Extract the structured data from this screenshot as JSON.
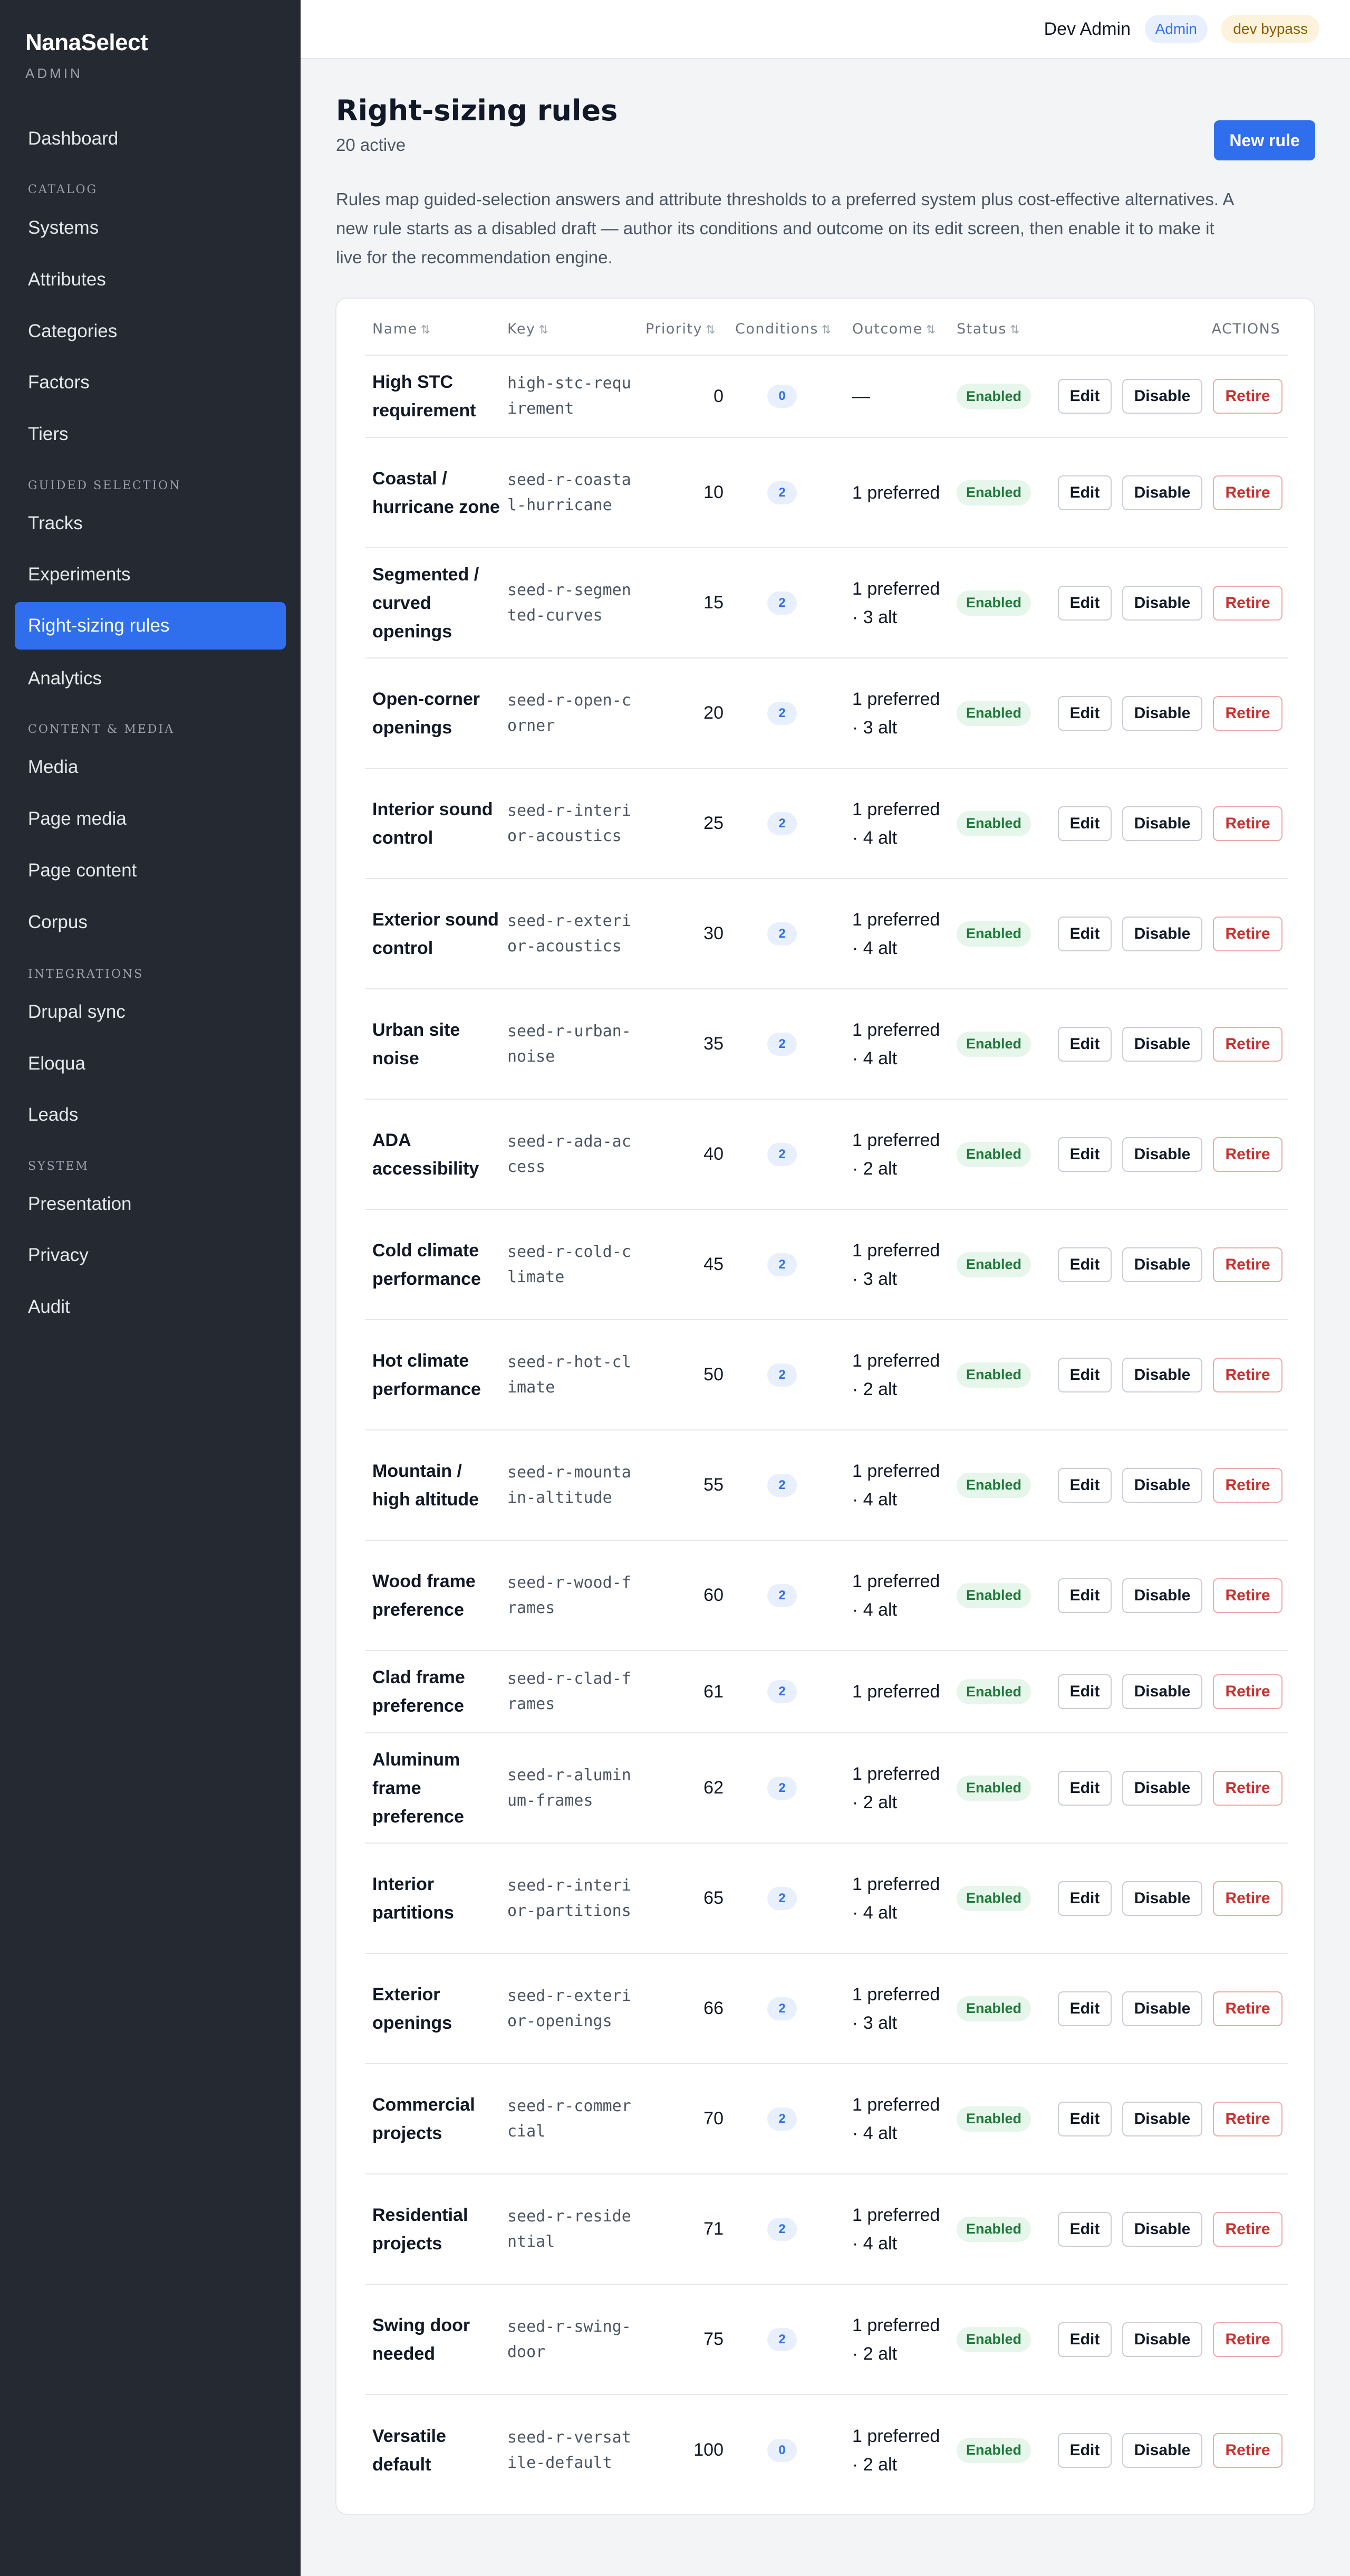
{
  "sidebar": {
    "brand": "NanaSelect",
    "brand_sub": "ADMIN",
    "sections": {
      "catalog": "CATALOG",
      "guided": "GUIDED SELECTION",
      "content": "CONTENT & MEDIA",
      "integrations": "INTEGRATIONS",
      "system": "SYSTEM"
    },
    "items": {
      "dashboard": "Dashboard",
      "systems": "Systems",
      "attributes": "Attributes",
      "categories": "Categories",
      "factors": "Factors",
      "tiers": "Tiers",
      "tracks": "Tracks",
      "experiments": "Experiments",
      "rightsizing": "Right-sizing rules",
      "analytics": "Analytics",
      "media": "Media",
      "page_media": "Page media",
      "page_content": "Page content",
      "corpus": "Corpus",
      "drupal": "Drupal sync",
      "eloqua": "Eloqua",
      "leads": "Leads",
      "presentation": "Presentation",
      "privacy": "Privacy",
      "audit": "Audit"
    }
  },
  "topbar": {
    "user": "Dev Admin",
    "role_badge": "Admin",
    "dev_badge": "dev bypass"
  },
  "header": {
    "title": "Right-sizing rules",
    "subtitle": "20 active",
    "new_button": "New rule",
    "intro": "Rules map guided-selection answers and attribute thresholds to a preferred system plus cost-effective alternatives. A new rule starts as a disabled draft — author its conditions and outcome on its edit screen, then enable it to make it live for the recommendation engine."
  },
  "table": {
    "columns": {
      "name": "Name",
      "key": "Key",
      "priority": "Priority",
      "conditions": "Conditions",
      "outcome": "Outcome",
      "status": "Status",
      "actions": "ACTIONS"
    },
    "action_labels": {
      "edit": "Edit",
      "disable": "Disable",
      "retire": "Retire"
    },
    "rows": [
      {
        "name": "High STC requirement",
        "key": "high-stc-requirement",
        "priority": "0",
        "conditions": "0",
        "outcome": "—",
        "status": "Enabled"
      },
      {
        "name": "Coastal / hurricane zone",
        "key": "seed-r-coastal-hurricane",
        "priority": "10",
        "conditions": "2",
        "outcome": "1 preferred",
        "status": "Enabled"
      },
      {
        "name": "Segmented / curved openings",
        "key": "seed-r-segmented-curves",
        "priority": "15",
        "conditions": "2",
        "outcome": "1 preferred · 3 alt",
        "status": "Enabled"
      },
      {
        "name": "Open-corner openings",
        "key": "seed-r-open-corner",
        "priority": "20",
        "conditions": "2",
        "outcome": "1 preferred · 3 alt",
        "status": "Enabled"
      },
      {
        "name": "Interior sound control",
        "key": "seed-r-interior-acoustics",
        "priority": "25",
        "conditions": "2",
        "outcome": "1 preferred · 4 alt",
        "status": "Enabled"
      },
      {
        "name": "Exterior sound control",
        "key": "seed-r-exterior-acoustics",
        "priority": "30",
        "conditions": "2",
        "outcome": "1 preferred · 4 alt",
        "status": "Enabled"
      },
      {
        "name": "Urban site noise",
        "key": "seed-r-urban-noise",
        "priority": "35",
        "conditions": "2",
        "outcome": "1 preferred · 4 alt",
        "status": "Enabled"
      },
      {
        "name": "ADA accessibility",
        "key": "seed-r-ada-access",
        "priority": "40",
        "conditions": "2",
        "outcome": "1 preferred · 2 alt",
        "status": "Enabled"
      },
      {
        "name": "Cold climate performance",
        "key": "seed-r-cold-climate",
        "priority": "45",
        "conditions": "2",
        "outcome": "1 preferred · 3 alt",
        "status": "Enabled"
      },
      {
        "name": "Hot climate performance",
        "key": "seed-r-hot-climate",
        "priority": "50",
        "conditions": "2",
        "outcome": "1 preferred · 2 alt",
        "status": "Enabled"
      },
      {
        "name": "Mountain / high altitude",
        "key": "seed-r-mountain-altitude",
        "priority": "55",
        "conditions": "2",
        "outcome": "1 preferred · 4 alt",
        "status": "Enabled"
      },
      {
        "name": "Wood frame preference",
        "key": "seed-r-wood-frames",
        "priority": "60",
        "conditions": "2",
        "outcome": "1 preferred · 4 alt",
        "status": "Enabled"
      },
      {
        "name": "Clad frame preference",
        "key": "seed-r-clad-frames",
        "priority": "61",
        "conditions": "2",
        "outcome": "1 preferred",
        "status": "Enabled"
      },
      {
        "name": "Aluminum frame preference",
        "key": "seed-r-aluminum-frames",
        "priority": "62",
        "conditions": "2",
        "outcome": "1 preferred · 2 alt",
        "status": "Enabled"
      },
      {
        "name": "Interior partitions",
        "key": "seed-r-interior-partitions",
        "priority": "65",
        "conditions": "2",
        "outcome": "1 preferred · 4 alt",
        "status": "Enabled"
      },
      {
        "name": "Exterior openings",
        "key": "seed-r-exterior-openings",
        "priority": "66",
        "conditions": "2",
        "outcome": "1 preferred · 3 alt",
        "status": "Enabled"
      },
      {
        "name": "Commercial projects",
        "key": "seed-r-commercial",
        "priority": "70",
        "conditions": "2",
        "outcome": "1 preferred · 4 alt",
        "status": "Enabled"
      },
      {
        "name": "Residential projects",
        "key": "seed-r-residential",
        "priority": "71",
        "conditions": "2",
        "outcome": "1 preferred · 4 alt",
        "status": "Enabled"
      },
      {
        "name": "Swing door needed",
        "key": "seed-r-swing-door",
        "priority": "75",
        "conditions": "2",
        "outcome": "1 preferred · 2 alt",
        "status": "Enabled"
      },
      {
        "name": "Versatile default",
        "key": "seed-r-versatile-default",
        "priority": "100",
        "conditions": "0",
        "outcome": "1 preferred · 2 alt",
        "status": "Enabled"
      }
    ]
  },
  "colors": {
    "sidebar_bg": "#252932",
    "accent": "#2f6fed",
    "enabled_bg": "#e6f6ea",
    "enabled_text": "#1f7a3a",
    "retire_text": "#c8312f",
    "dev_badge_bg": "#fdf3dc"
  }
}
